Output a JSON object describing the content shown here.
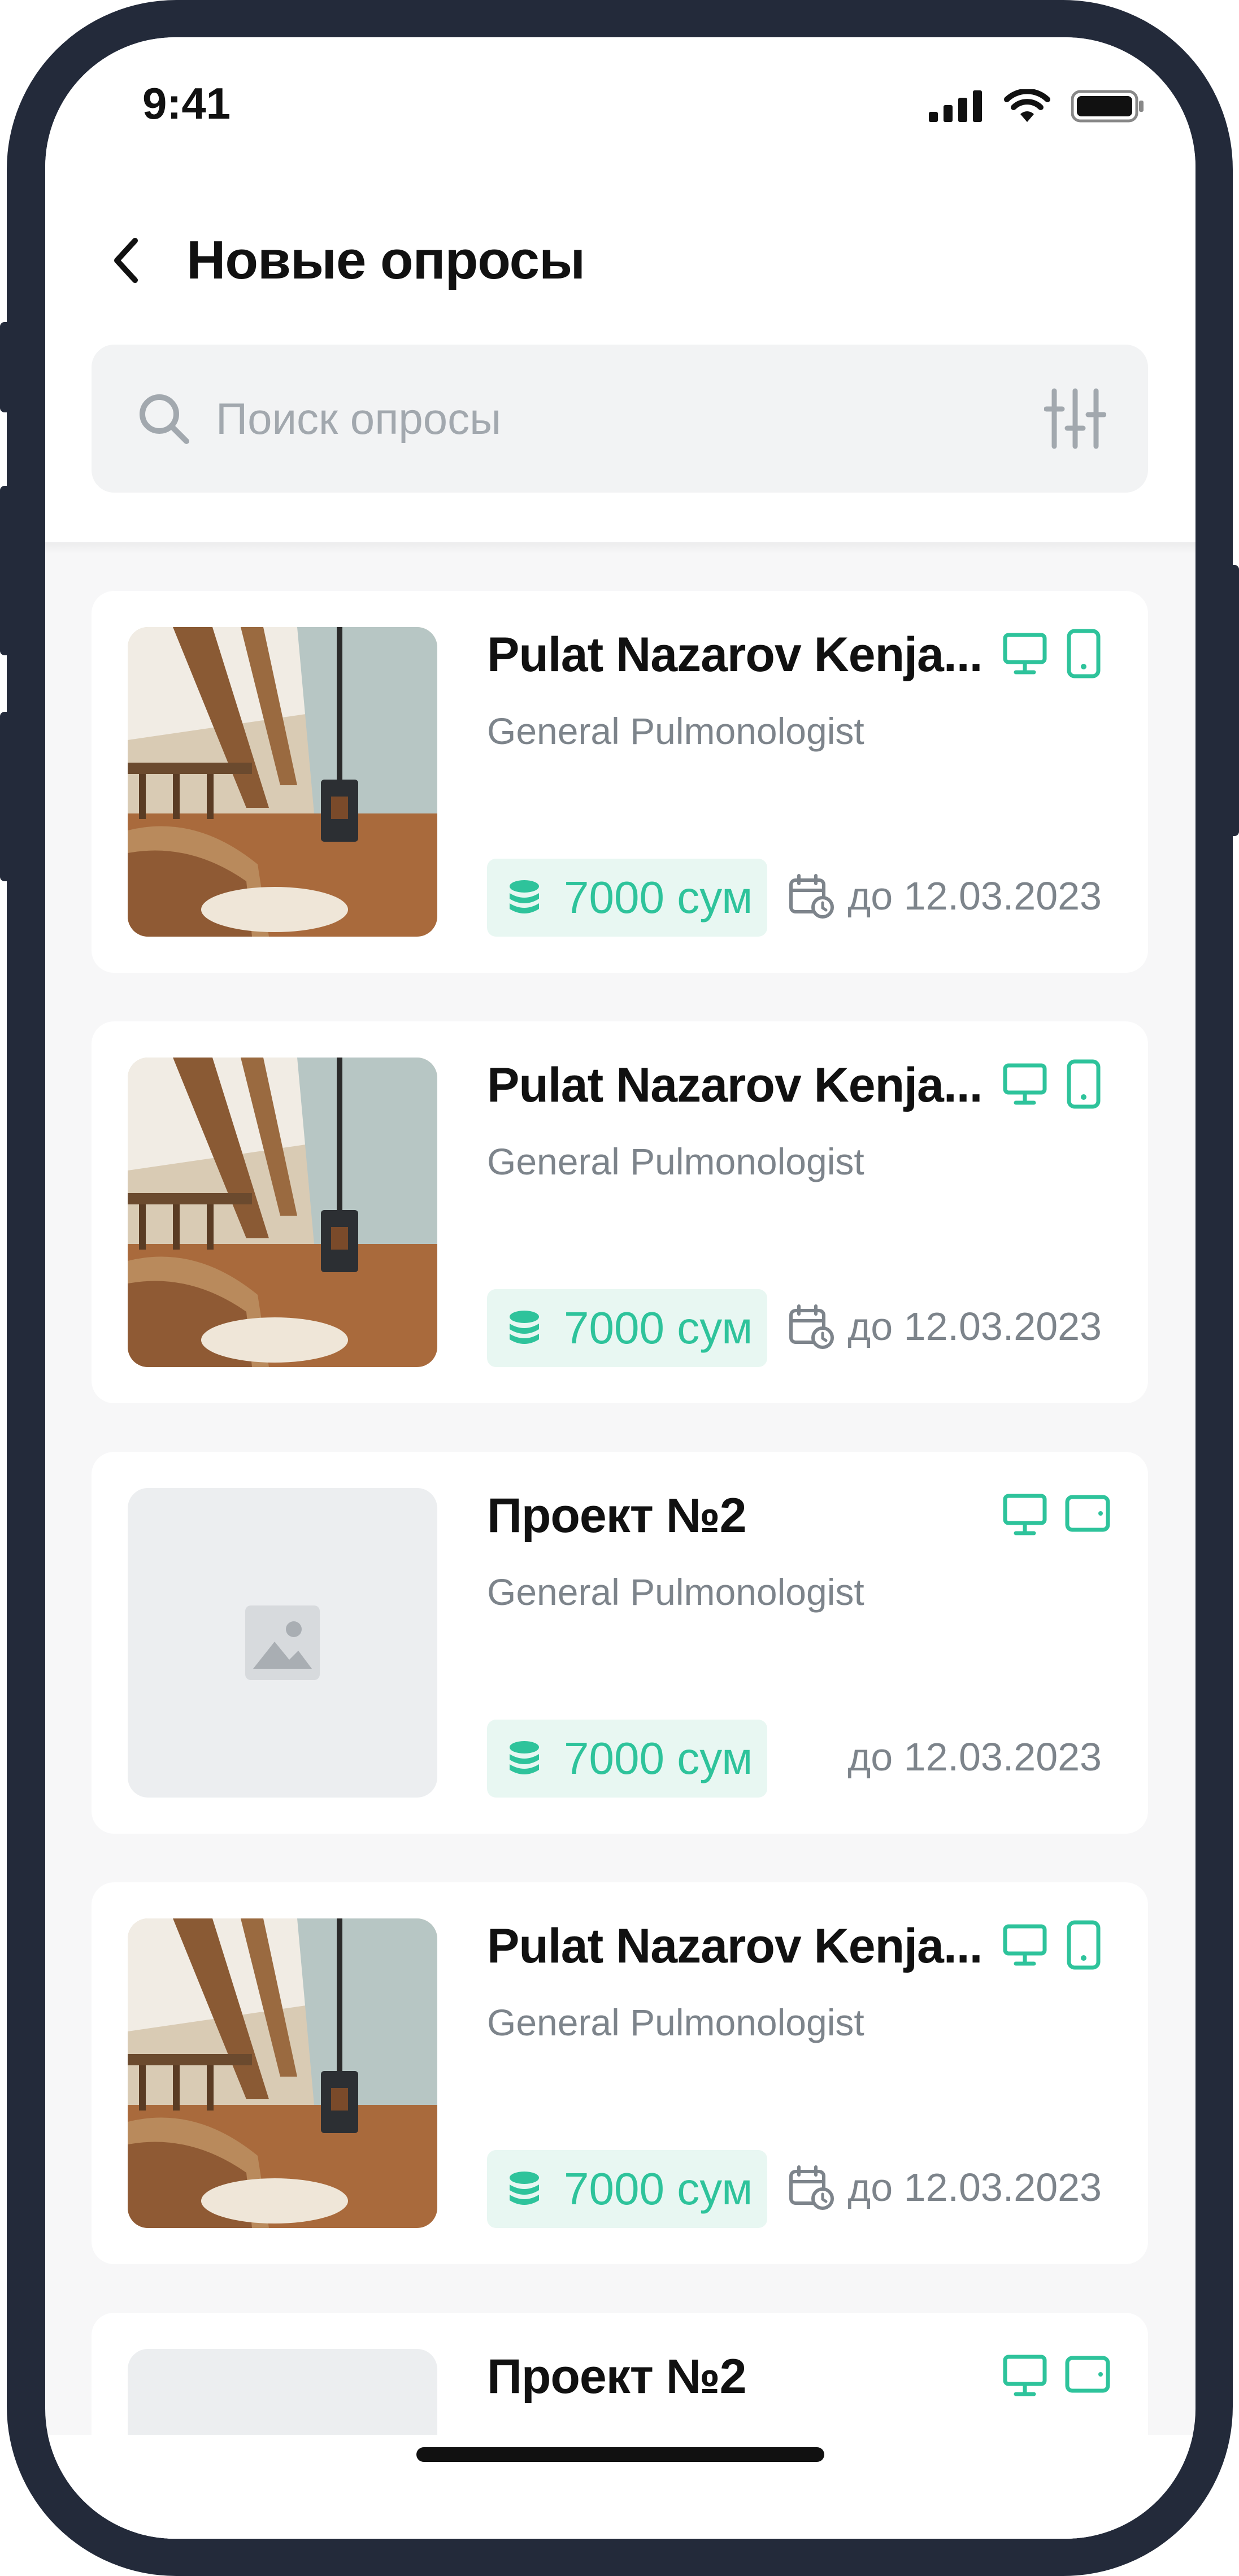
{
  "status_bar": {
    "time": "9:41"
  },
  "header": {
    "title": "Новые опросы"
  },
  "search": {
    "placeholder": "Поиск опросы"
  },
  "colors": {
    "accent": "#2ec39b",
    "accent_bg": "#e8f7f2",
    "frame": "#232a3a"
  },
  "cards": [
    {
      "title": "Pulat Nazarov Kenja...",
      "subtitle": "General Pulmonologist",
      "price": "7000 сум",
      "deadline": "до 12.03.2023",
      "has_image": true,
      "devices": [
        "desktop-icon",
        "phone-icon"
      ]
    },
    {
      "title": "Pulat Nazarov Kenja...",
      "subtitle": "General Pulmonologist",
      "price": "7000 сум",
      "deadline": "до 12.03.2023",
      "has_image": true,
      "devices": [
        "desktop-icon",
        "phone-icon"
      ]
    },
    {
      "title": "Проект №2",
      "subtitle": "General Pulmonologist",
      "price": "7000 сум",
      "deadline": "до 12.03.2023",
      "has_image": false,
      "devices": [
        "desktop-icon",
        "tablet-icon"
      ]
    },
    {
      "title": "Pulat Nazarov Kenja...",
      "subtitle": "General Pulmonologist",
      "price": "7000 сум",
      "deadline": "до 12.03.2023",
      "has_image": true,
      "devices": [
        "desktop-icon",
        "phone-icon"
      ]
    },
    {
      "title": "Проект №2",
      "has_image": false,
      "devices": [
        "desktop-icon",
        "tablet-icon"
      ]
    }
  ]
}
